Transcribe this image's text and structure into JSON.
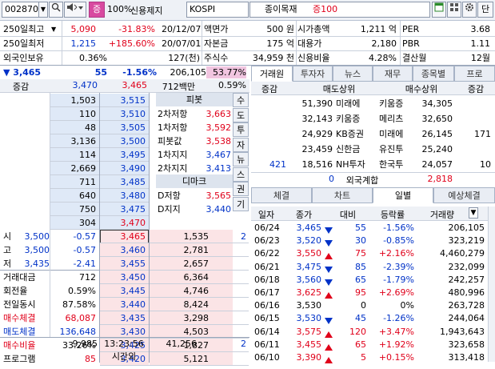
{
  "topbar": {
    "code": "002870",
    "percent_btn": "100%",
    "status": "신용제지",
    "market": "KOSPI",
    "sector": "종이목재",
    "margin": "증100",
    "dan": "단"
  },
  "info": {
    "r1": [
      "250일최고",
      "5,090",
      "-31.83%",
      "20/12/07",
      "액면가",
      "500 원",
      "시가총액",
      "1,211 억",
      "PER",
      "3.68"
    ],
    "r2": [
      "250일최저",
      "1,215",
      "+185.60%",
      "20/07/01",
      "자본금",
      "175 억",
      "대용가",
      "2,180",
      "PBR",
      "1.11"
    ],
    "r3": [
      "외국인보유",
      "0.36%",
      "127(천)",
      "주식수",
      "34,959 천",
      "신용비율",
      "4.28%",
      "결산월",
      "12월"
    ]
  },
  "quote": {
    "price": "3,465",
    "change": "55",
    "rate": "-1.56%",
    "volume": "206,105",
    "ratio": "53.77%"
  },
  "ob_header": {
    "label": "증감",
    "total_ask": "3,470",
    "price": "3,465",
    "amount": "712백만",
    "amount_rate": "0.59%"
  },
  "asks": [
    {
      "qty": "1,503",
      "price": "3,515"
    },
    {
      "qty": "110",
      "price": "3,510"
    },
    {
      "qty": "48",
      "price": "3,505"
    },
    {
      "qty": "3,136",
      "price": "3,500"
    },
    {
      "qty": "114",
      "price": "3,495"
    },
    {
      "qty": "2,669",
      "price": "3,490"
    },
    {
      "qty": "711",
      "price": "3,485"
    },
    {
      "qty": "640",
      "price": "3,480"
    },
    {
      "qty": "750",
      "price": "3,475"
    },
    {
      "qty": "304",
      "price": "3,470"
    }
  ],
  "pivot": {
    "title": "피봇",
    "rows": [
      [
        "2차저항",
        "3,663"
      ],
      [
        "1차저항",
        "3,592"
      ],
      [
        "피봇값",
        "3,538"
      ],
      [
        "1차지지",
        "3,467"
      ],
      [
        "2차지지",
        "3,413"
      ]
    ]
  },
  "demark": {
    "title": "디마크",
    "rows": [
      [
        "D저항",
        "3,565"
      ],
      [
        "D지지",
        "3,440"
      ]
    ]
  },
  "side_tabs": [
    "수",
    "도",
    "투",
    "자",
    "뉴",
    "스",
    "권",
    "기"
  ],
  "left_stats": [
    {
      "label": "시",
      "val": "3,500",
      "chg": "-0.57"
    },
    {
      "label": "고",
      "val": "3,500",
      "chg": "-0.57"
    },
    {
      "label": "저",
      "val": "3,435",
      "chg": "-2.41"
    },
    {
      "label": "거래대금",
      "val": "712",
      "chg": ""
    },
    {
      "label": "회전율",
      "val": "0.59%",
      "chg": ""
    },
    {
      "label": "전일동시",
      "val": "87.58%",
      "chg": ""
    },
    {
      "label": "매수체결",
      "val": "68,087",
      "chg": ""
    },
    {
      "label": "매도체결",
      "val": "136,648",
      "chg": ""
    },
    {
      "label": "매수비율",
      "val": "33.26%",
      "chg": ""
    },
    {
      "label": "프로그램",
      "val": "85",
      "chg": ""
    }
  ],
  "bids": [
    {
      "price": "3,465",
      "qty": "1,535"
    },
    {
      "price": "3,460",
      "qty": "2,781"
    },
    {
      "price": "3,455",
      "qty": "2,657"
    },
    {
      "price": "3,450",
      "qty": "6,364"
    },
    {
      "price": "3,445",
      "qty": "4,746"
    },
    {
      "price": "3,440",
      "qty": "8,424"
    },
    {
      "price": "3,435",
      "qty": "3,298"
    },
    {
      "price": "3,430",
      "qty": "4,503"
    },
    {
      "price": "3,425",
      "qty": "1,827"
    },
    {
      "price": "3,420",
      "qty": "5,121"
    }
  ],
  "ob_footer": {
    "ask_total": "9,985",
    "time": "13:23:56",
    "time_label": "시간외",
    "bid_total": "41,256",
    "bid_extra": "2"
  },
  "broker": {
    "tabs": [
      "거래원",
      "투자자",
      "뉴스",
      "재무",
      "종목별",
      "프로"
    ],
    "cols": [
      "증감",
      "매도상위",
      "매수상위",
      "증감"
    ],
    "rows": [
      [
        "",
        "51,390",
        "미래에",
        "키움증",
        "34,305",
        ""
      ],
      [
        "",
        "32,143",
        "키움증",
        "메리츠",
        "32,650",
        ""
      ],
      [
        "",
        "24,929",
        "KB증권",
        "미래에",
        "26,145",
        "171"
      ],
      [
        "",
        "23,459",
        "신한금",
        "유진투",
        "25,240",
        ""
      ],
      [
        "421",
        "18,516",
        "NH투자",
        "한국투",
        "24,057",
        "10"
      ]
    ],
    "foreign": [
      "0",
      "외국계합",
      "2,818"
    ]
  },
  "daily": {
    "tabs": [
      "체결",
      "차트",
      "일별",
      "예상체결"
    ],
    "cols": [
      "일자",
      "종가",
      "대비",
      "등락률",
      "거래량"
    ],
    "rows": [
      {
        "d": "06/24",
        "p": "3,465",
        "dir": "dn",
        "c": "55",
        "r": "-1.56%",
        "v": "206,105"
      },
      {
        "d": "06/23",
        "p": "3,520",
        "dir": "dn",
        "c": "30",
        "r": "-0.85%",
        "v": "323,219"
      },
      {
        "d": "06/22",
        "p": "3,550",
        "dir": "up",
        "c": "75",
        "r": "+2.16%",
        "v": "4,460,279"
      },
      {
        "d": "06/21",
        "p": "3,475",
        "dir": "dn",
        "c": "85",
        "r": "-2.39%",
        "v": "232,099"
      },
      {
        "d": "06/18",
        "p": "3,560",
        "dir": "dn",
        "c": "65",
        "r": "-1.79%",
        "v": "242,257"
      },
      {
        "d": "06/17",
        "p": "3,625",
        "dir": "up",
        "c": "95",
        "r": "+2.69%",
        "v": "480,996"
      },
      {
        "d": "06/16",
        "p": "3,530",
        "dir": "",
        "c": "0",
        "r": "0%",
        "v": "263,728"
      },
      {
        "d": "06/15",
        "p": "3,530",
        "dir": "dn",
        "c": "45",
        "r": "-1.26%",
        "v": "244,064"
      },
      {
        "d": "06/14",
        "p": "3,575",
        "dir": "up",
        "c": "120",
        "r": "+3.47%",
        "v": "1,943,643"
      },
      {
        "d": "06/11",
        "p": "3,455",
        "dir": "up",
        "c": "65",
        "r": "+1.92%",
        "v": "323,658"
      },
      {
        "d": "06/10",
        "p": "3,390",
        "dir": "up",
        "c": "5",
        "r": "+0.15%",
        "v": "313,418"
      }
    ]
  },
  "colors": {
    "red": "#e0001a",
    "blue": "#0032c8",
    "askBg": "#dfe9f7",
    "bidBg": "#fbe4e6"
  }
}
